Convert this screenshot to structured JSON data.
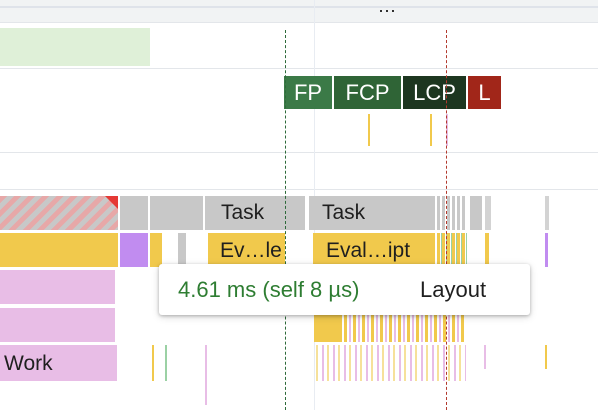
{
  "toolbar": {
    "more_label": "⋯"
  },
  "markers": [
    {
      "label": "FP",
      "color": "#3b7a47"
    },
    {
      "label": "FCP",
      "color": "#2f6436"
    },
    {
      "label": "LCP",
      "color": "#1d3620"
    },
    {
      "label": "L",
      "color": "#a12619"
    }
  ],
  "tracks": {
    "task_1": "Task",
    "task_2": "Task",
    "event_1": "Ev…le",
    "event_2": "Eval…ipt",
    "work_label": "Work"
  },
  "tooltip": {
    "time_text": "4.61 ms (self 8 µs)",
    "name_text": "Layout"
  },
  "colors": {
    "task_gray": "#c8c8c8",
    "script_yellow": "#f1c94c",
    "rendering_purple": "#c18cf0",
    "painting_pink": "#e8bde6",
    "network_green": "#dff0d8",
    "timing_text_green": "#2e7d32"
  }
}
